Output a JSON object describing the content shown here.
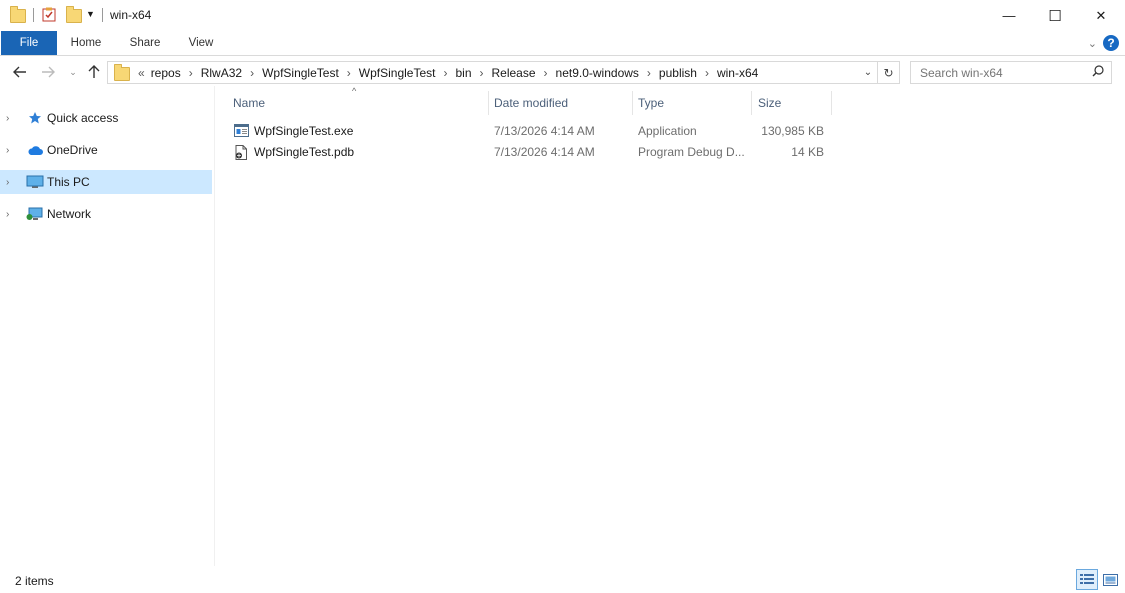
{
  "window": {
    "title": "win-x64"
  },
  "window_controls": {
    "minimize": "—",
    "maximize": "☐",
    "close": "✕"
  },
  "ribbon": {
    "tabs": [
      "File",
      "Home",
      "Share",
      "View"
    ],
    "help_label": "?"
  },
  "address": {
    "overflow": "«",
    "crumbs": [
      "repos",
      "RlwA32",
      "WpfSingleTest",
      "WpfSingleTest",
      "bin",
      "Release",
      "net9.0-windows",
      "publish",
      "win-x64"
    ]
  },
  "search": {
    "placeholder": "Search win-x64"
  },
  "nav_pane": {
    "items": [
      {
        "label": "Quick access",
        "icon": "star-icon"
      },
      {
        "label": "OneDrive",
        "icon": "cloud-icon"
      },
      {
        "label": "This PC",
        "icon": "computer-icon",
        "selected": true
      },
      {
        "label": "Network",
        "icon": "network-icon"
      }
    ]
  },
  "columns": [
    "Name",
    "Date modified",
    "Type",
    "Size"
  ],
  "files": [
    {
      "name": "WpfSingleTest.exe",
      "date": "7/13/2026 4:14 AM",
      "type": "Application",
      "size": "130,985 KB",
      "icon": "exe-file-icon"
    },
    {
      "name": "WpfSingleTest.pdb",
      "date": "7/13/2026 4:14 AM",
      "type": "Program Debug D...",
      "size": "14 KB",
      "icon": "pdb-file-icon"
    }
  ],
  "status": {
    "item_count": "2 items"
  },
  "colors": {
    "accent": "#1a65b5",
    "selection": "#cce8ff",
    "header_text": "#4c607a"
  }
}
